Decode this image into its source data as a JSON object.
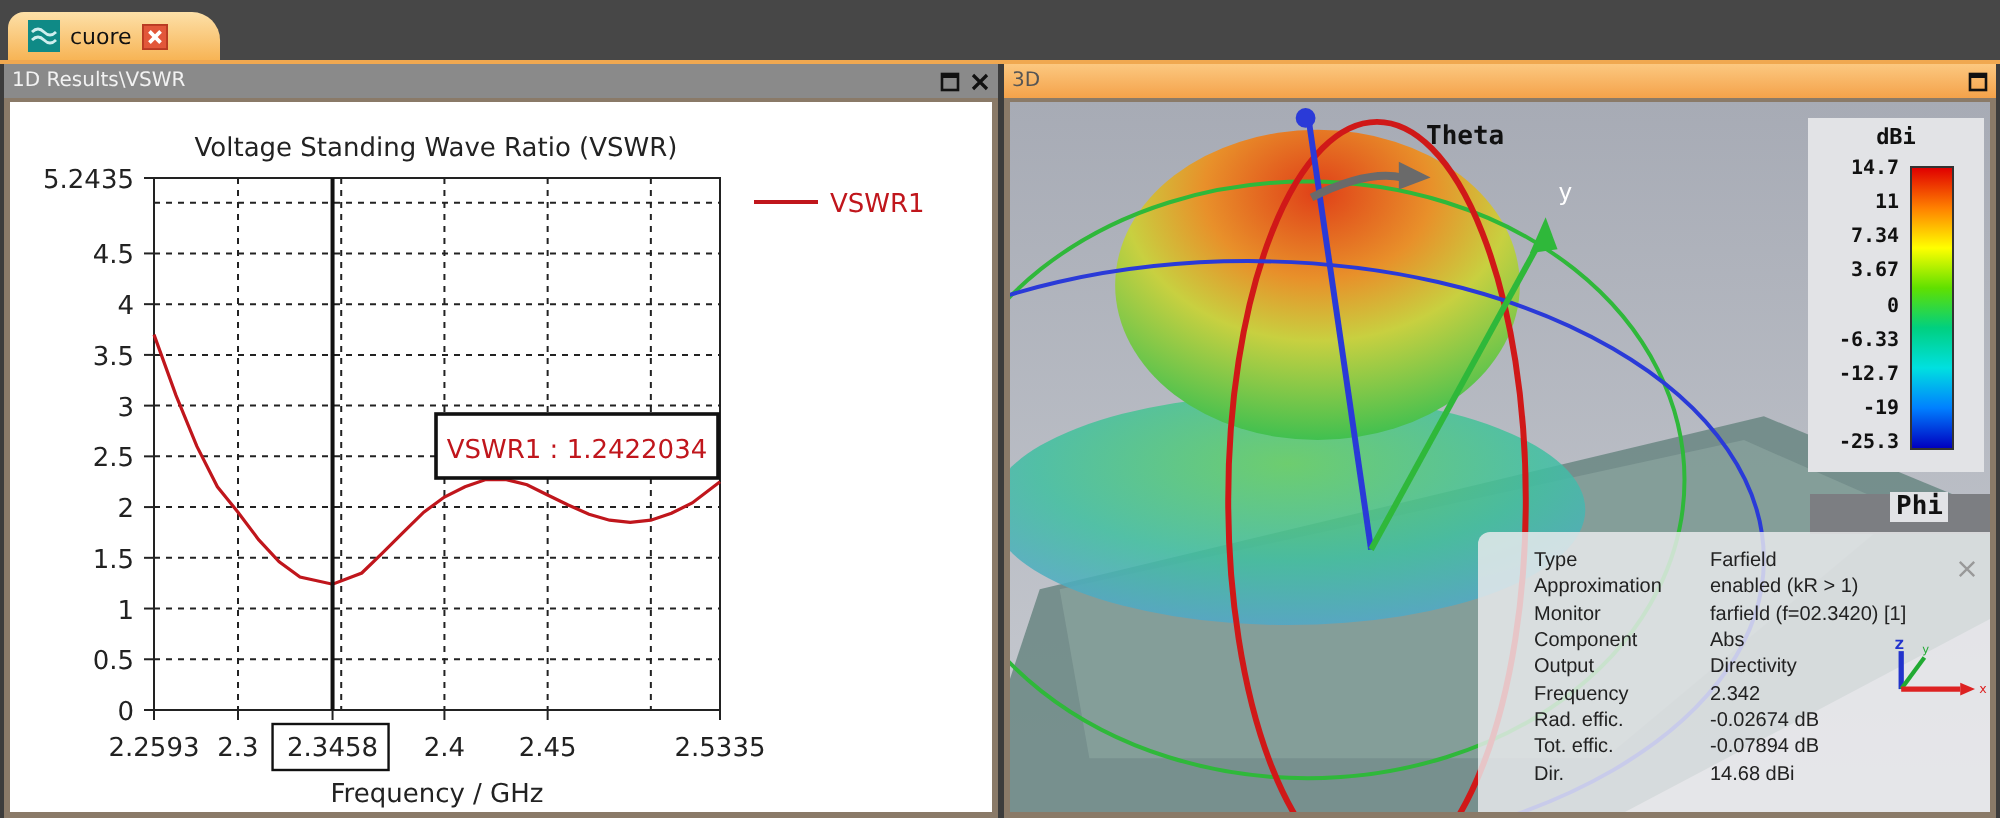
{
  "document_tab": {
    "title": "cuore",
    "selected": true
  },
  "left_panel": {
    "title": "1D Results\\VSWR",
    "chart_data": {
      "type": "line",
      "title": "Voltage Standing Wave Ratio (VSWR)",
      "xlabel": "Frequency / GHz",
      "xlim": [
        2.2593,
        2.5335
      ],
      "ylim": [
        0,
        5.2435
      ],
      "xticks": [
        2.2593,
        2.3,
        2.3458,
        2.4,
        2.45,
        2.5335
      ],
      "yticks": [
        0,
        0.5,
        1,
        1.5,
        2,
        2.5,
        3,
        3.5,
        4,
        4.5,
        5.2435
      ],
      "x": [
        2.2593,
        2.27,
        2.28,
        2.29,
        2.3,
        2.31,
        2.32,
        2.33,
        2.3458,
        2.36,
        2.37,
        2.38,
        2.39,
        2.4,
        2.41,
        2.42,
        2.43,
        2.44,
        2.45,
        2.46,
        2.47,
        2.48,
        2.49,
        2.5,
        2.51,
        2.52,
        2.5335
      ],
      "series": [
        {
          "name": "VSWR1",
          "color": "#c0161c",
          "values": [
            3.7,
            3.1,
            2.6,
            2.2,
            1.95,
            1.68,
            1.46,
            1.31,
            1.24,
            1.35,
            1.55,
            1.75,
            1.95,
            2.1,
            2.2,
            2.27,
            2.27,
            2.22,
            2.12,
            2.02,
            1.93,
            1.87,
            1.85,
            1.87,
            1.94,
            2.04,
            2.25
          ]
        }
      ],
      "grid": true,
      "ref_lines": [
        {
          "axis": "x",
          "value": 2.3458,
          "color": "#111111"
        }
      ],
      "annotations": [
        "VSWR1 : 1.2422034"
      ]
    }
  },
  "right_panel": {
    "title": "3D",
    "theta_label": "Theta",
    "phi_label": "Phi",
    "y_label": "y",
    "color_legend": {
      "unit": "dBi",
      "labels": [
        "14.7",
        "11",
        "7.34",
        "3.67",
        "0",
        "-6.33",
        "-12.7",
        "-19",
        "-25.3"
      ]
    },
    "info": [
      {
        "label": "Type",
        "value": "Farfield"
      },
      {
        "label": "Approximation",
        "value": "enabled (kR > 1)"
      },
      {
        "label": "Monitor",
        "value": "farfield (f=02.3420) [1]"
      },
      {
        "label": "Component",
        "value": "Abs"
      },
      {
        "label": "Output",
        "value": "Directivity"
      },
      {
        "label": "Frequency",
        "value": "2.342"
      },
      {
        "label": "Rad. effic.",
        "value": "-0.02674 dB"
      },
      {
        "label": "Tot. effic.",
        "value": "-0.07894 dB"
      },
      {
        "label": "Dir.",
        "value": "14.68 dBi"
      }
    ],
    "triad": {
      "z": "Z",
      "y": "y",
      "x": "x"
    }
  }
}
